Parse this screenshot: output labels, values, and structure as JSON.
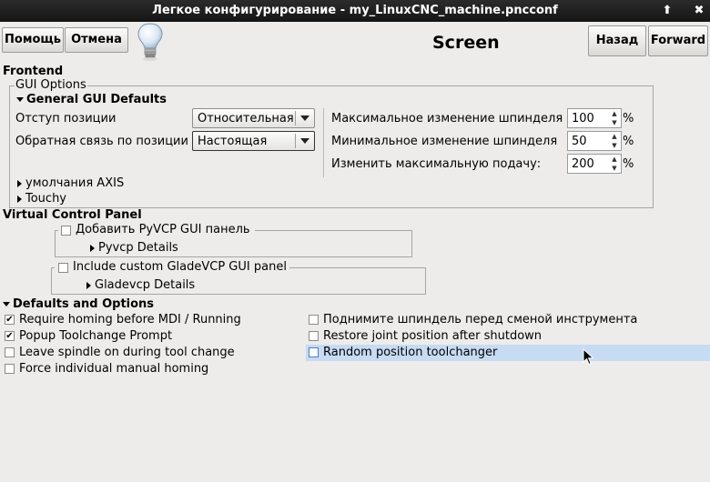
{
  "window": {
    "title": "Легкое конфигурирование - my_LinuxCNC_machine.pncconf",
    "up_glyph": "⬆",
    "close_glyph": "✖"
  },
  "toolbar": {
    "help_label": "Помощь",
    "cancel_label": "Отмена",
    "page_title": "Screen",
    "back_label": "Назад",
    "forward_label": "Forward"
  },
  "frontend": {
    "heading": "Frontend",
    "gui_options_label": "GUI Options",
    "general_defaults_label": "General GUI Defaults",
    "position_offset_label": "Отступ позиции",
    "position_offset_value": "Относительная",
    "position_feedback_label": "Обратная связь по позиции",
    "position_feedback_value": "Настоящая",
    "max_spindle_override_label": "Максимальное изменение шпинделя",
    "max_spindle_override_value": "100",
    "min_spindle_override_label": "Минимальное изменение шпинделя",
    "min_spindle_override_value": "50",
    "max_feed_override_label": "Изменить максимальную подачу:",
    "max_feed_override_value": "200",
    "percent": "%",
    "axis_defaults_label": "умолчания AXIS",
    "touchy_label": "Touchy"
  },
  "vcp": {
    "heading": "Virtual Control Panel",
    "pyvcp_checkbox_label": "Добавить PyVCP GUI панель",
    "pyvcp_details_label": "Pyvcp Details",
    "gladevcp_checkbox_label": "Include custom GladeVCP GUI panel",
    "gladevcp_details_label": "Gladevcp Details"
  },
  "defaults": {
    "heading": "Defaults and Options",
    "check_glyph": "✔",
    "left_options": [
      {
        "label": "Require homing before MDI / Running",
        "checked": true
      },
      {
        "label": "Popup Toolchange Prompt",
        "checked": true
      },
      {
        "label": "Leave spindle on during tool change",
        "checked": false
      },
      {
        "label": "Force individual manual homing",
        "checked": false
      }
    ],
    "right_options": [
      {
        "label": "Поднимите шпиндель перед сменой инструмента",
        "checked": false
      },
      {
        "label": "Restore joint position after shutdown",
        "checked": false
      },
      {
        "label": "Random position toolchanger",
        "checked": false
      }
    ]
  }
}
